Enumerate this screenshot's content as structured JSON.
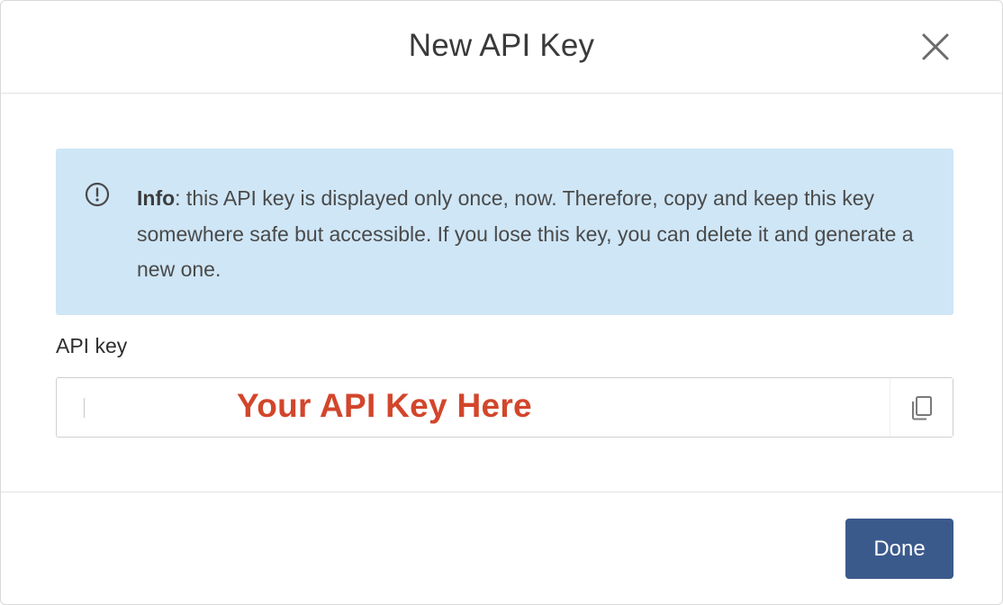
{
  "dialog": {
    "title": "New API Key",
    "close_icon": "close-icon"
  },
  "info": {
    "icon": "info-circle-icon",
    "label": "Info",
    "message": ": this API key is displayed only once, now. Therefore, copy and keep this key somewhere safe but accessible. If you lose this key, you can delete it and generate a new one."
  },
  "api_key": {
    "label": "API key",
    "value": "Your API Key Here",
    "copy_icon": "copy-icon"
  },
  "footer": {
    "done_label": "Done"
  },
  "colors": {
    "info_background": "#cfe6f6",
    "key_text": "#d2462b",
    "primary_button": "#3b5a8c"
  }
}
